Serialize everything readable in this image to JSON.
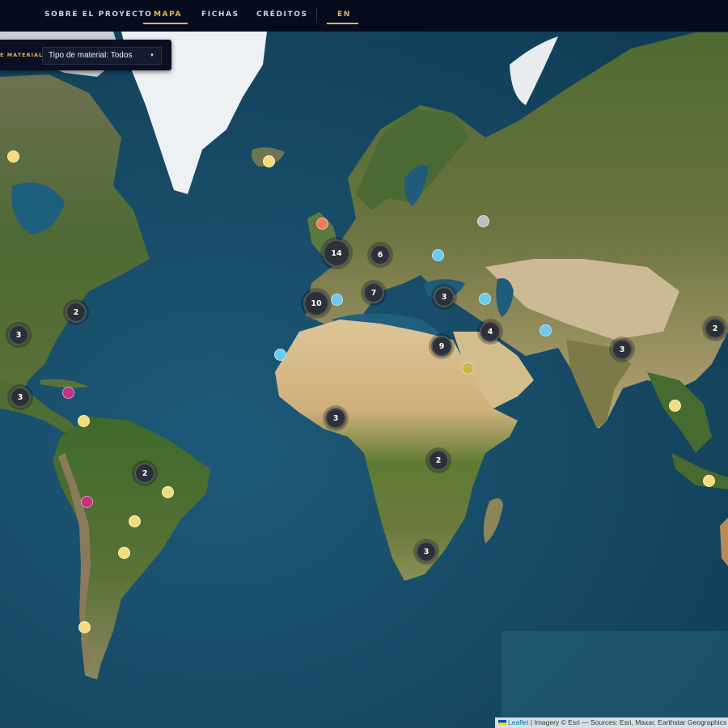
{
  "nav": {
    "items": [
      {
        "label": "SOBRE EL PROYECTO",
        "active": false
      },
      {
        "label": "MAPA",
        "active": true
      },
      {
        "label": "FICHAS",
        "active": false
      },
      {
        "label": "CRÉDITOS",
        "active": false
      }
    ],
    "language": "EN"
  },
  "filter": {
    "label": "E MATERIAL:",
    "selected": "Tipo de material: Todos"
  },
  "colors": {
    "accent": "#e2b65a",
    "cluster": "#2c3138",
    "yellow": "#f3dc7c",
    "blue": "#6cc9ef",
    "magenta": "#c2317a",
    "salmon": "#ef7a5c",
    "gray": "#bdbdbd",
    "olive": "#c8b84a"
  },
  "clusters": [
    {
      "count": "14",
      "region": "britain-france"
    },
    {
      "count": "6",
      "region": "central-europe"
    },
    {
      "count": "10",
      "region": "iberia"
    },
    {
      "count": "7",
      "region": "italy"
    },
    {
      "count": "3",
      "region": "black-sea"
    },
    {
      "count": "4",
      "region": "iran"
    },
    {
      "count": "9",
      "region": "egypt"
    },
    {
      "count": "2",
      "region": "east-usa"
    },
    {
      "count": "3",
      "region": "southeast-usa"
    },
    {
      "count": "3",
      "region": "mexico"
    },
    {
      "count": "3",
      "region": "west-africa"
    },
    {
      "count": "2",
      "region": "east-africa"
    },
    {
      "count": "3",
      "region": "southern-africa"
    },
    {
      "count": "2",
      "region": "brazil"
    },
    {
      "count": "3",
      "region": "india"
    },
    {
      "count": "2",
      "region": "china"
    }
  ],
  "points": [
    {
      "color": "yellow",
      "region": "canada"
    },
    {
      "color": "yellow",
      "region": "iceland"
    },
    {
      "color": "salmon",
      "region": "britain"
    },
    {
      "color": "gray",
      "region": "russia"
    },
    {
      "color": "blue",
      "region": "ukraine"
    },
    {
      "color": "blue",
      "region": "portugal"
    },
    {
      "color": "blue",
      "region": "caucasus"
    },
    {
      "color": "blue",
      "region": "canary-islands"
    },
    {
      "color": "blue",
      "region": "afghanistan"
    },
    {
      "color": "olive",
      "region": "arabia"
    },
    {
      "color": "magenta",
      "region": "caribbean"
    },
    {
      "color": "yellow",
      "region": "colombia"
    },
    {
      "color": "yellow",
      "region": "brazil-east"
    },
    {
      "color": "magenta",
      "region": "peru"
    },
    {
      "color": "yellow",
      "region": "bolivia"
    },
    {
      "color": "yellow",
      "region": "paraguay"
    },
    {
      "color": "yellow",
      "region": "chile"
    },
    {
      "color": "yellow",
      "region": "thailand"
    },
    {
      "color": "yellow",
      "region": "indonesia"
    }
  ],
  "attribution": {
    "leaflet": "Leaflet",
    "text": " | Imagery © Esri — Sources: Esri, Maxar, Earthstar Geographics"
  }
}
